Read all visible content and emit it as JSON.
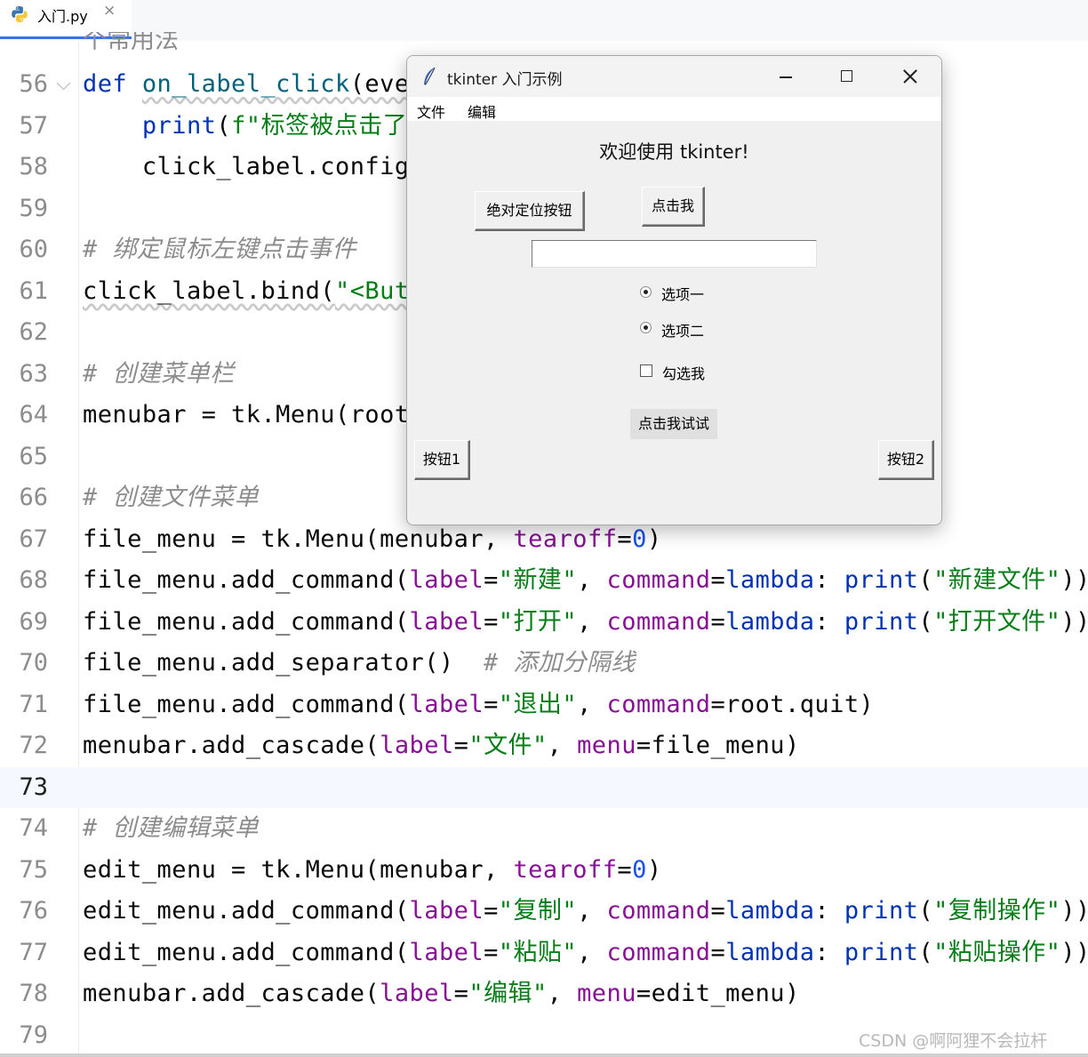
{
  "tab": {
    "filename": "入门.py",
    "close": "×"
  },
  "editor": {
    "partial_top_text": "个常用法",
    "lines": [
      {
        "num": "56",
        "current": false,
        "fold": true,
        "tokens": [
          {
            "t": "def ",
            "c": "kw"
          },
          {
            "t": "on_label_click",
            "c": "fn squig"
          },
          {
            "t": "(even",
            "c": "squig"
          }
        ]
      },
      {
        "num": "57",
        "current": false,
        "tokens": [
          {
            "t": "    "
          },
          {
            "t": "print",
            "c": "kw"
          },
          {
            "t": "("
          },
          {
            "t": "f\"标签被点击了，",
            "c": "str"
          }
        ]
      },
      {
        "num": "58",
        "current": false,
        "tokens": [
          {
            "t": "    click_label.config("
          }
        ]
      },
      {
        "num": "59",
        "current": false,
        "tokens": []
      },
      {
        "num": "60",
        "current": false,
        "tokens": [
          {
            "t": "# 绑定鼠标左键点击事件",
            "c": "cmt"
          }
        ]
      },
      {
        "num": "61",
        "current": false,
        "tokens": [
          {
            "t": "click_label.bind(",
            "c": "squig"
          },
          {
            "t": "\"<Butt",
            "c": "str squig"
          }
        ]
      },
      {
        "num": "62",
        "current": false,
        "tokens": []
      },
      {
        "num": "63",
        "current": false,
        "tokens": [
          {
            "t": "# 创建菜单栏",
            "c": "cmt"
          }
        ]
      },
      {
        "num": "64",
        "current": false,
        "tokens": [
          {
            "t": "menubar = tk.Menu(root)"
          }
        ]
      },
      {
        "num": "65",
        "current": false,
        "tokens": []
      },
      {
        "num": "66",
        "current": false,
        "tokens": [
          {
            "t": "# 创建文件菜单",
            "c": "cmt"
          }
        ]
      },
      {
        "num": "67",
        "current": false,
        "tokens": [
          {
            "t": "file_menu = tk.Menu(menubar, "
          },
          {
            "t": "tearoff",
            "c": "param"
          },
          {
            "t": "="
          },
          {
            "t": "0",
            "c": "num"
          },
          {
            "t": ")"
          }
        ]
      },
      {
        "num": "68",
        "current": false,
        "tokens": [
          {
            "t": "file_menu.add_command("
          },
          {
            "t": "label",
            "c": "param"
          },
          {
            "t": "="
          },
          {
            "t": "\"新建\"",
            "c": "str"
          },
          {
            "t": ", "
          },
          {
            "t": "command",
            "c": "param"
          },
          {
            "t": "="
          },
          {
            "t": "lambda",
            "c": "kw"
          },
          {
            "t": ": "
          },
          {
            "t": "print",
            "c": "kw"
          },
          {
            "t": "("
          },
          {
            "t": "\"新建文件\"",
            "c": "str"
          },
          {
            "t": "))"
          }
        ]
      },
      {
        "num": "69",
        "current": false,
        "tokens": [
          {
            "t": "file_menu.add_command("
          },
          {
            "t": "label",
            "c": "param"
          },
          {
            "t": "="
          },
          {
            "t": "\"打开\"",
            "c": "str"
          },
          {
            "t": ", "
          },
          {
            "t": "command",
            "c": "param"
          },
          {
            "t": "="
          },
          {
            "t": "lambda",
            "c": "kw"
          },
          {
            "t": ": "
          },
          {
            "t": "print",
            "c": "kw"
          },
          {
            "t": "("
          },
          {
            "t": "\"打开文件\"",
            "c": "str"
          },
          {
            "t": "))"
          }
        ]
      },
      {
        "num": "70",
        "current": false,
        "tokens": [
          {
            "t": "file_menu.add_separator()  "
          },
          {
            "t": "# 添加分隔线",
            "c": "cmt"
          }
        ]
      },
      {
        "num": "71",
        "current": false,
        "tokens": [
          {
            "t": "file_menu.add_command("
          },
          {
            "t": "label",
            "c": "param"
          },
          {
            "t": "="
          },
          {
            "t": "\"退出\"",
            "c": "str"
          },
          {
            "t": ", "
          },
          {
            "t": "command",
            "c": "param"
          },
          {
            "t": "=root.quit)"
          }
        ]
      },
      {
        "num": "72",
        "current": false,
        "tokens": [
          {
            "t": "menubar.add_cascade("
          },
          {
            "t": "label",
            "c": "param"
          },
          {
            "t": "="
          },
          {
            "t": "\"文件\"",
            "c": "str"
          },
          {
            "t": ", "
          },
          {
            "t": "menu",
            "c": "param"
          },
          {
            "t": "=file_menu)"
          }
        ]
      },
      {
        "num": "73",
        "current": true,
        "tokens": []
      },
      {
        "num": "74",
        "current": false,
        "tokens": [
          {
            "t": "# 创建编辑菜单",
            "c": "cmt"
          }
        ]
      },
      {
        "num": "75",
        "current": false,
        "tokens": [
          {
            "t": "edit_menu = tk.Menu(menubar, "
          },
          {
            "t": "tearoff",
            "c": "param"
          },
          {
            "t": "="
          },
          {
            "t": "0",
            "c": "num"
          },
          {
            "t": ")"
          }
        ]
      },
      {
        "num": "76",
        "current": false,
        "tokens": [
          {
            "t": "edit_menu.add_command("
          },
          {
            "t": "label",
            "c": "param"
          },
          {
            "t": "="
          },
          {
            "t": "\"复制\"",
            "c": "str"
          },
          {
            "t": ", "
          },
          {
            "t": "command",
            "c": "param"
          },
          {
            "t": "="
          },
          {
            "t": "lambda",
            "c": "kw"
          },
          {
            "t": ": "
          },
          {
            "t": "print",
            "c": "kw"
          },
          {
            "t": "("
          },
          {
            "t": "\"复制操作\"",
            "c": "str"
          },
          {
            "t": "))"
          }
        ]
      },
      {
        "num": "77",
        "current": false,
        "tokens": [
          {
            "t": "edit_menu.add_command("
          },
          {
            "t": "label",
            "c": "param"
          },
          {
            "t": "="
          },
          {
            "t": "\"粘贴\"",
            "c": "str"
          },
          {
            "t": ", "
          },
          {
            "t": "command",
            "c": "param"
          },
          {
            "t": "="
          },
          {
            "t": "lambda",
            "c": "kw"
          },
          {
            "t": ": "
          },
          {
            "t": "print",
            "c": "kw"
          },
          {
            "t": "("
          },
          {
            "t": "\"粘贴操作\"",
            "c": "str"
          },
          {
            "t": "))"
          }
        ]
      },
      {
        "num": "78",
        "current": false,
        "tokens": [
          {
            "t": "menubar.add_cascade("
          },
          {
            "t": "label",
            "c": "param"
          },
          {
            "t": "="
          },
          {
            "t": "\"编辑\"",
            "c": "str"
          },
          {
            "t": ", "
          },
          {
            "t": "menu",
            "c": "param"
          },
          {
            "t": "=edit_menu)"
          }
        ]
      },
      {
        "num": "79",
        "current": false,
        "tokens": []
      }
    ]
  },
  "tkwin": {
    "title": "tkinter 入门示例",
    "menus": [
      "文件",
      "编辑"
    ],
    "welcome": "欢迎使用 tkinter!",
    "btn_absolute": "绝对定位按钮",
    "btn_click_me": "点击我",
    "entry_value": "",
    "radio1": "选项一",
    "radio2": "选项二",
    "checkbox": "勾选我",
    "checkbox_checked": false,
    "btn_try": "点击我试试",
    "btn1": "按钮1",
    "btn2": "按钮2"
  },
  "watermark": "CSDN @啊阿狸不会拉杆"
}
